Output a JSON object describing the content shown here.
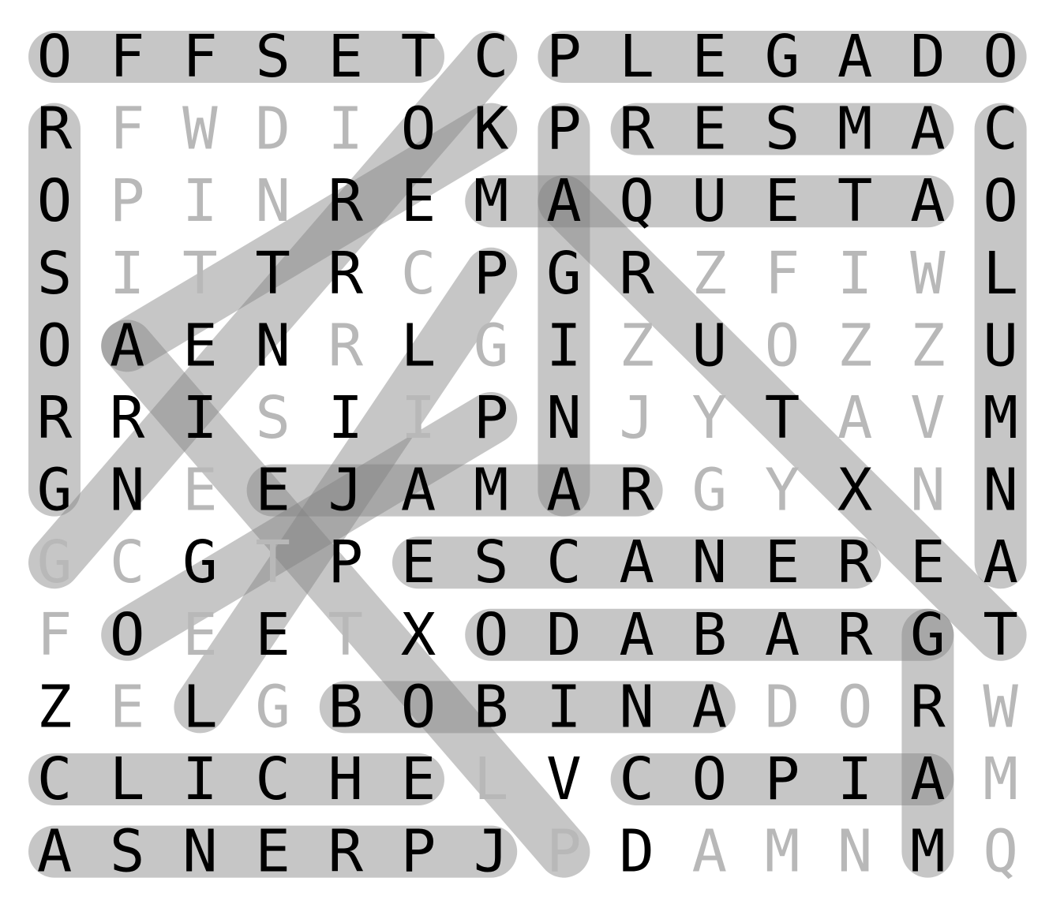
{
  "puzzle": {
    "grid": [
      "OFFSETCPLEGADO",
      "RFWDIOKPRESMAC",
      "OPINREMAQUETAO",
      "SITTRCPGRZFIWL",
      "OAENRLGIZUOZZU",
      "RRISIIPNJYTAVM",
      "GNEEJAMARGYXNN",
      "GCGTPESCANEREA",
      "FOETXODABARGT",
      "ZELGBOBINADORW",
      "CLICHELVCOPIAM",
      "ASNERPJPDAMNMQ"
    ],
    "rows": [
      [
        "O",
        "F",
        "F",
        "S",
        "E",
        "T",
        "C",
        "P",
        "L",
        "E",
        "G",
        "A",
        "D",
        "O"
      ],
      [
        "R",
        "F",
        "W",
        "D",
        "I",
        "O",
        "K",
        "P",
        "R",
        "E",
        "S",
        "M",
        "A",
        "C"
      ],
      [
        "O",
        "P",
        "I",
        "N",
        "R",
        "E",
        "M",
        "A",
        "Q",
        "U",
        "E",
        "T",
        "A",
        "O"
      ],
      [
        "S",
        "I",
        "T",
        "T",
        "R",
        "C",
        "P",
        "G",
        "R",
        "Z",
        "F",
        "I",
        "W",
        "L"
      ],
      [
        "O",
        "A",
        "E",
        "N",
        "R",
        "L",
        "G",
        "I",
        "Z",
        "U",
        "O",
        "Z",
        "Z",
        "U"
      ],
      [
        "R",
        "R",
        "I",
        "S",
        "I",
        "I",
        "P",
        "N",
        "J",
        "Y",
        "T",
        "A",
        "V",
        "M"
      ],
      [
        "G",
        "N",
        "E",
        "E",
        "J",
        "A",
        "M",
        "A",
        "R",
        "G",
        "Y",
        "X",
        "N",
        "N"
      ],
      [
        "G",
        "C",
        "G",
        "T",
        "P",
        "E",
        "S",
        "C",
        "A",
        "N",
        "E",
        "R",
        "E",
        "A"
      ],
      [
        "F",
        "O",
        "E",
        "E",
        "T",
        "X",
        "O",
        "D",
        "A",
        "B",
        "A",
        "R",
        "G",
        "T"
      ],
      [
        "Z",
        "E",
        "L",
        "G",
        "B",
        "O",
        "B",
        "I",
        "N",
        "A",
        "D",
        "O",
        "R",
        "W"
      ],
      [
        "C",
        "L",
        "I",
        "C",
        "H",
        "E",
        "L",
        "V",
        "C",
        "O",
        "P",
        "I",
        "A",
        "M"
      ],
      [
        "A",
        "S",
        "N",
        "E",
        "R",
        "P",
        "J",
        "P",
        "D",
        "A",
        "M",
        "N",
        "M",
        "Q"
      ]
    ],
    "highlight_color": "#808080",
    "found_letter_color": "#000000",
    "free_letter_color": "#b8b8b8",
    "found_words": [
      {
        "word": "OFFSET",
        "start": [
          0,
          0
        ],
        "end": [
          0,
          5
        ]
      },
      {
        "word": "PLEGADO",
        "start": [
          0,
          7
        ],
        "end": [
          0,
          13
        ]
      },
      {
        "word": "PRESMA",
        "start": [
          1,
          8
        ],
        "end": [
          1,
          12
        ]
      },
      {
        "word": "MAQUETA",
        "start": [
          2,
          6
        ],
        "end": [
          2,
          12
        ]
      },
      {
        "word": "ENGRANAJE",
        "start": [
          6,
          8
        ],
        "end": [
          6,
          3
        ]
      },
      {
        "word": "PESCANER",
        "start": [
          7,
          5
        ],
        "end": [
          7,
          11
        ]
      },
      {
        "word": "ODABARG",
        "start": [
          8,
          6
        ],
        "end": [
          8,
          12
        ]
      },
      {
        "word": "BOBINA",
        "start": [
          9,
          4
        ],
        "end": [
          9,
          9
        ]
      },
      {
        "word": "CLICHE",
        "start": [
          10,
          0
        ],
        "end": [
          10,
          5
        ]
      },
      {
        "word": "COPIA",
        "start": [
          10,
          8
        ],
        "end": [
          10,
          12
        ]
      },
      {
        "word": "ASNERP",
        "start": [
          11,
          0
        ],
        "end": [
          11,
          6
        ]
      },
      {
        "word": "ROSORGG",
        "start": [
          1,
          0
        ],
        "end": [
          6,
          0
        ]
      },
      {
        "word": "COLUMNA",
        "start": [
          1,
          13
        ],
        "end": [
          7,
          13
        ]
      },
      {
        "word": "PAGINA",
        "start": [
          1,
          7
        ],
        "end": [
          6,
          7
        ]
      },
      {
        "word": "GRAM",
        "start": [
          8,
          12
        ],
        "end": [
          11,
          12
        ]
      }
    ],
    "diagonals": [
      {
        "start": [
          0,
          6
        ],
        "end": [
          7,
          0
        ]
      },
      {
        "start": [
          1,
          6
        ],
        "end": [
          4,
          1
        ]
      },
      {
        "start": [
          3,
          6
        ],
        "end": [
          9,
          2
        ]
      },
      {
        "start": [
          5,
          6
        ],
        "end": [
          8,
          1
        ]
      },
      {
        "start": [
          2,
          7
        ],
        "end": [
          8,
          13
        ]
      },
      {
        "start": [
          4,
          1
        ],
        "end": [
          11,
          7
        ]
      }
    ]
  }
}
